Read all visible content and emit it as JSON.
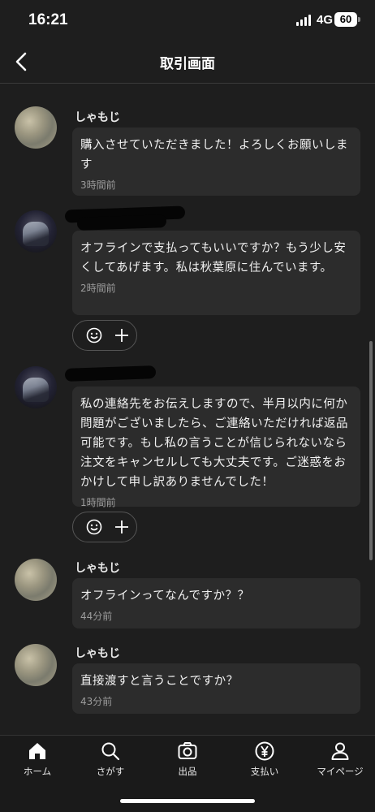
{
  "status": {
    "time": "16:21",
    "network": "4G",
    "battery": "60"
  },
  "nav": {
    "title": "取引画面",
    "back_icon": "chevron-left-icon"
  },
  "messages": [
    {
      "name": "しゃもじ",
      "text": "購入させていただきました！よろしくお願いします",
      "time": "3時間前"
    },
    {
      "name": "",
      "text": "オフラインで支払ってもいいですか？もう少し安くしてあげます。私は秋葉原に住んでいます。",
      "time": "2時間前"
    },
    {
      "name": "",
      "text": "私の連絡先をお伝えしますので、半月以内に何か問題がございましたら、ご連絡いただければ返品可能です。もし私の言うことが信じられないなら注文をキャンセルしても大丈夫です。ご迷惑をおかけして申し訳ありませんでした！",
      "time": "1時間前"
    },
    {
      "name": "しゃもじ",
      "text": "オフラインってなんですか？？",
      "time": "44分前"
    },
    {
      "name": "しゃもじ",
      "text": "直接渡すと言うことですか？",
      "time": "43分前"
    }
  ],
  "tabs": [
    {
      "label": "ホーム",
      "icon": "home-icon"
    },
    {
      "label": "さがす",
      "icon": "search-icon"
    },
    {
      "label": "出品",
      "icon": "camera-icon"
    },
    {
      "label": "支払い",
      "icon": "yen-icon"
    },
    {
      "label": "マイページ",
      "icon": "person-icon"
    }
  ]
}
